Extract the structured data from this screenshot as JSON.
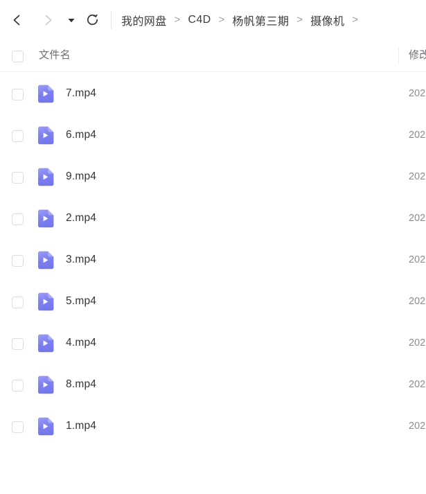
{
  "toolbar": {
    "back_label": "back-navigation",
    "forward_label": "forward-navigation",
    "dropdown_label": "history-dropdown",
    "refresh_label": "refresh"
  },
  "breadcrumb": {
    "separator": ">",
    "items": [
      {
        "label": "我的网盘"
      },
      {
        "label": "C4D"
      },
      {
        "label": "杨帆第三期"
      },
      {
        "label": "摄像机"
      }
    ],
    "trailing_separator": ">"
  },
  "table": {
    "columns": {
      "name": "文件名",
      "mtime": "修改"
    },
    "rows": [
      {
        "name": "7.mp4",
        "mtime": "202",
        "icon": "video-file-icon",
        "checked": false
      },
      {
        "name": "6.mp4",
        "mtime": "202",
        "icon": "video-file-icon",
        "checked": false
      },
      {
        "name": "9.mp4",
        "mtime": "202",
        "icon": "video-file-icon",
        "checked": false
      },
      {
        "name": "2.mp4",
        "mtime": "202",
        "icon": "video-file-icon",
        "checked": false
      },
      {
        "name": "3.mp4",
        "mtime": "202",
        "icon": "video-file-icon",
        "checked": false
      },
      {
        "name": "5.mp4",
        "mtime": "202",
        "icon": "video-file-icon",
        "checked": false
      },
      {
        "name": "4.mp4",
        "mtime": "202",
        "icon": "video-file-icon",
        "checked": false
      },
      {
        "name": "8.mp4",
        "mtime": "202",
        "icon": "video-file-icon",
        "checked": false
      },
      {
        "name": "1.mp4",
        "mtime": "202",
        "icon": "video-file-icon",
        "checked": false
      }
    ]
  },
  "colors": {
    "video_icon": "#7b7cee",
    "video_icon_light": "#9a9bf4",
    "text_primary": "#33333a",
    "text_secondary": "#6d6d75",
    "divider": "#eeeef0",
    "checkbox_border": "#dddde0",
    "icon_dark": "#333338",
    "icon_disabled": "#c8c8cc"
  }
}
